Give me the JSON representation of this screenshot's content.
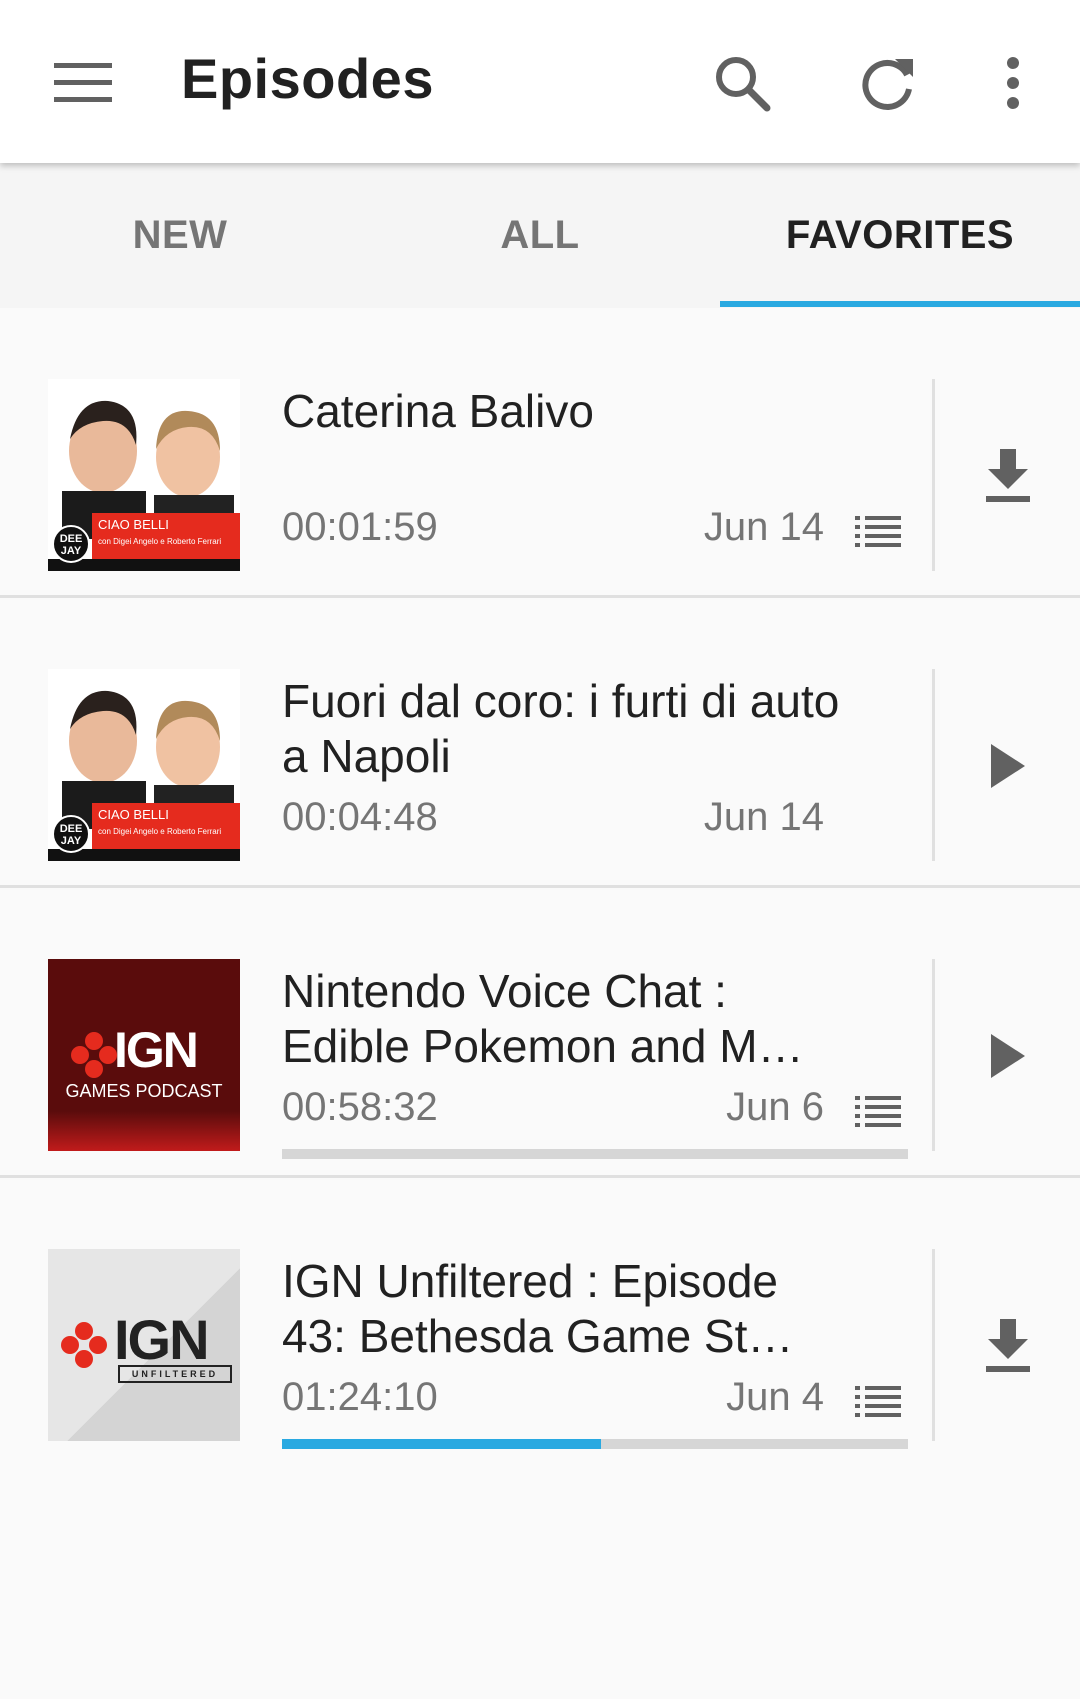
{
  "header": {
    "title": "Episodes",
    "icons": [
      "menu-icon",
      "search-icon",
      "refresh-icon",
      "more-vert-icon"
    ]
  },
  "tabs": [
    {
      "label": "NEW",
      "active": false
    },
    {
      "label": "ALL",
      "active": false
    },
    {
      "label": "FAVORITES",
      "active": true
    }
  ],
  "colors": {
    "accent": "#29a9e1",
    "text_primary": "#212121",
    "text_secondary": "#757575"
  },
  "episodes": [
    {
      "title": "Caterina Balivo",
      "duration": "00:01:59",
      "date": "Jun 14",
      "in_queue": true,
      "action": "download-icon",
      "progress": null,
      "thumb": {
        "podcast": "CIAO BELLI",
        "credits": "con Digei Angelo e Roberto Ferrari",
        "network": "DEE JAY"
      }
    },
    {
      "title": "Fuori dal coro: i furti di auto a Napoli",
      "duration": "00:04:48",
      "date": "Jun 14",
      "in_queue": false,
      "action": "play-icon",
      "progress": null,
      "thumb": {
        "podcast": "CIAO BELLI",
        "credits": "con Digei Angelo e Roberto Ferrari",
        "network": "DEE JAY"
      }
    },
    {
      "title": "Nintendo Voice Chat : Edible Pokemon and M…",
      "duration": "00:58:32",
      "date": "Jun 6",
      "in_queue": true,
      "action": "play-icon",
      "progress": 0.0,
      "thumb": {
        "brand": "IGN",
        "subtitle": "GAMES PODCAST"
      }
    },
    {
      "title": "IGN Unfiltered : Episode 43: Bethesda Game St…",
      "duration": "01:24:10",
      "date": "Jun 4",
      "in_queue": true,
      "action": "download-icon",
      "progress": 0.51,
      "thumb": {
        "brand": "IGN",
        "subtitle": "UNFILTERED"
      }
    }
  ]
}
